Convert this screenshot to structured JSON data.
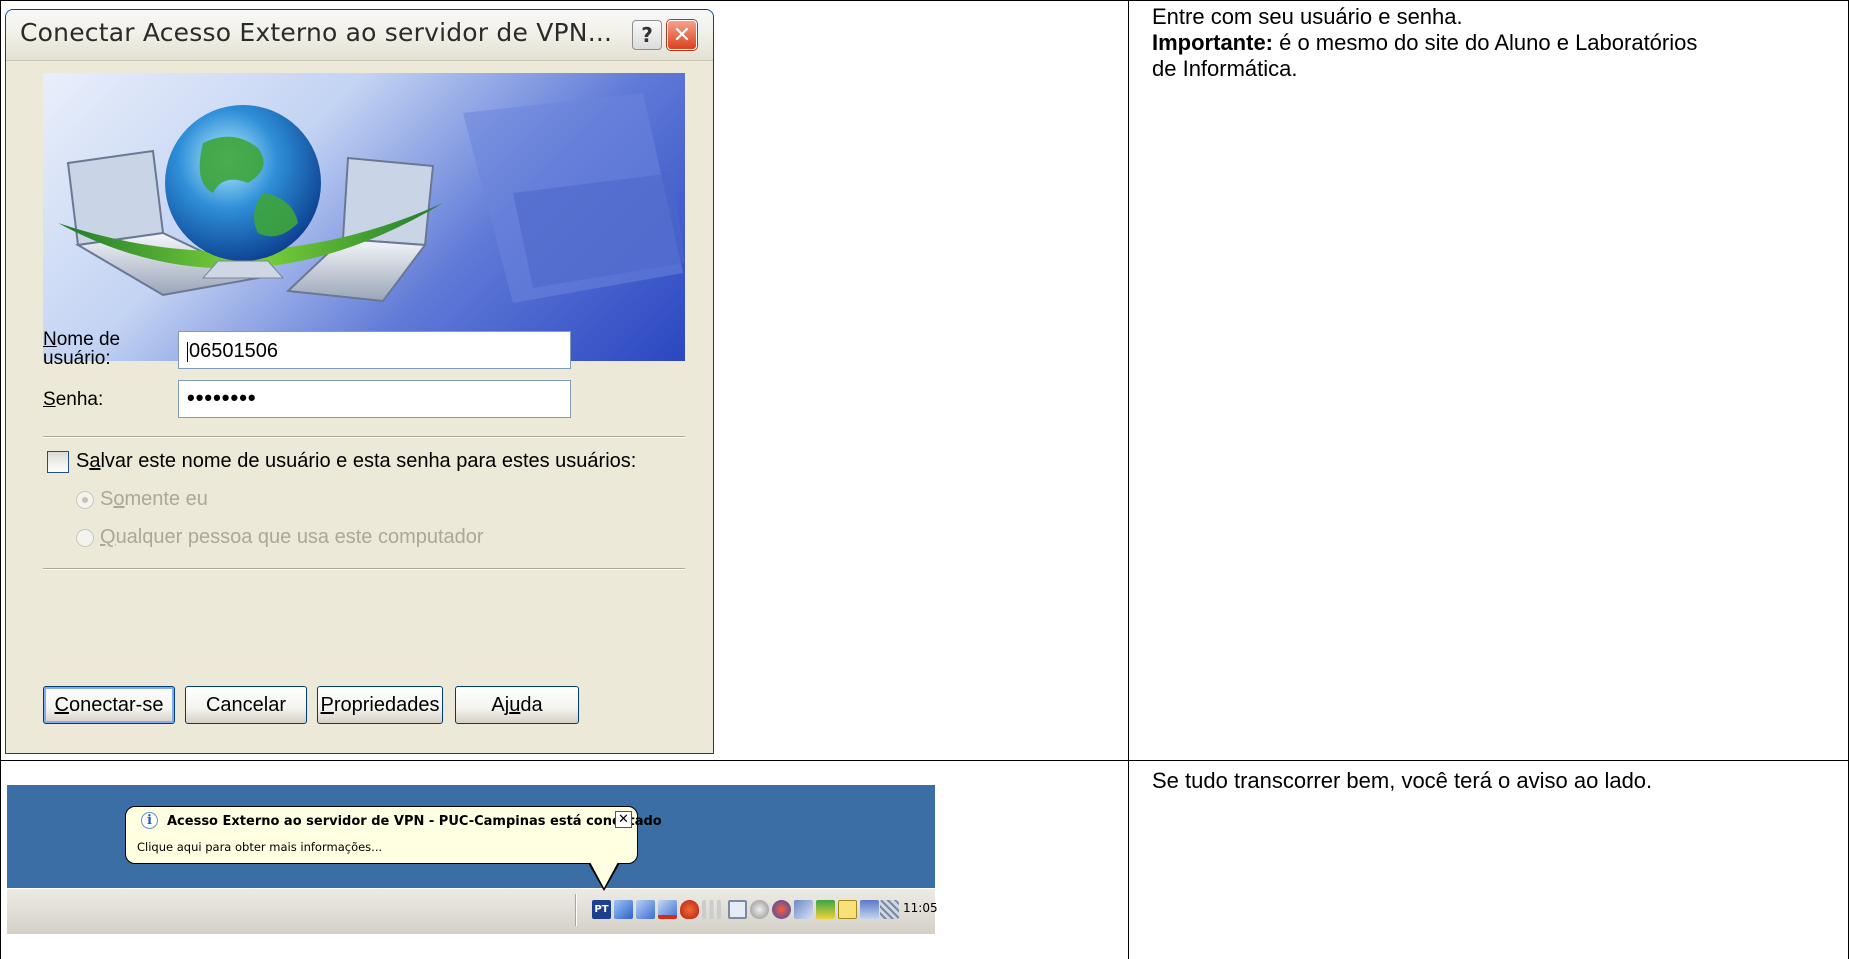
{
  "dialog": {
    "title": "Conectar Acesso Externo ao servidor de VPN...",
    "help_glyph": "?",
    "close_glyph": "✕",
    "username_label_line1_first": "N",
    "username_label_line1_rest": "ome de",
    "username_label_line2": "usuário:",
    "username_value": "06501506",
    "password_label_first": "S",
    "password_label_rest": "enha:",
    "password_value": "••••••••",
    "save_label_pre": "S",
    "save_label_ul": "a",
    "save_label_rest": "lvar este nome de usuário e esta senha para estes usuários:",
    "radio_only_me_pre": "S",
    "radio_only_me_ul": "o",
    "radio_only_me_rest": "mente eu",
    "radio_anyone_ul": "Q",
    "radio_anyone_rest": "ualquer pessoa que usa este computador",
    "buttons": {
      "connect_ul": "C",
      "connect_rest": "onectar-se",
      "cancel": "Cancelar",
      "properties_ul": "P",
      "properties_rest": "ropriedades",
      "help_pre": "Aj",
      "help_ul": "u",
      "help_rest": "da"
    }
  },
  "instructions": {
    "line1": "Entre com seu usuário e senha.",
    "important_label": "Importante:",
    "important_text": " é o mesmo do site do Aluno e Laboratórios",
    "important_text2": "de Informática.",
    "step2": "Se tudo transcorrer bem, você terá o aviso ao lado."
  },
  "notification": {
    "title": "Acesso Externo ao servidor de VPN - PUC-Campinas está conectado",
    "text": "Clique aqui para obter mais informações...",
    "close_glyph": "✕"
  },
  "taskbar": {
    "clock": "11:05",
    "tray_icons": [
      "pt-language-icon",
      "network-connection-icon",
      "network-icon",
      "network-disconnected-icon",
      "shield-icon",
      "signal-icon",
      "monitor-icon",
      "settings-icon",
      "antivirus-icon",
      "phone-icon",
      "chart-icon",
      "counter-icon",
      "display-icon",
      "grid-icon"
    ]
  },
  "colors": {
    "xp_blue_border": "#0831d9",
    "dialog_bg": "#ece9d8",
    "desktop": "#3a6ea5",
    "balloon": "#ffffe1"
  }
}
